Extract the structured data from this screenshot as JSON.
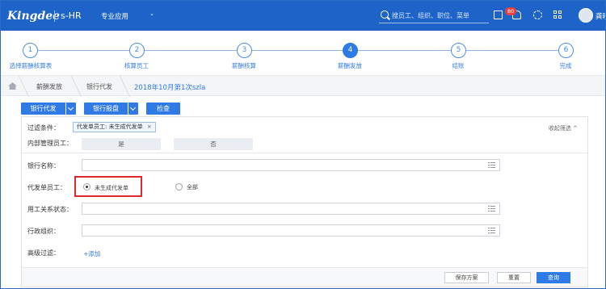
{
  "header": {
    "logo": "Kingdee",
    "product": "s-HR",
    "menu_label": "专业应用",
    "menu_caret": "⌄",
    "search_placeholder": "搜员工、组织、职位、菜单",
    "notification_count": "80",
    "user_name": "龚晓"
  },
  "steps": [
    {
      "num": "1",
      "label": "选择薪酬核算表"
    },
    {
      "num": "2",
      "label": "核算员工"
    },
    {
      "num": "3",
      "label": "薪酬核算"
    },
    {
      "num": "4",
      "label": "薪酬发放",
      "active": true
    },
    {
      "num": "5",
      "label": "结账"
    },
    {
      "num": "6",
      "label": "完成"
    }
  ],
  "breadcrumb": {
    "items": [
      "薪酬发放",
      "银行代发",
      "2018年10月第1次szla"
    ]
  },
  "toolbar": {
    "bank_payment": "银行代发",
    "bank_report": "银行报盘",
    "check": "检查"
  },
  "filter": {
    "condition_label": "过滤条件：",
    "condition_tag": "代发单员工: 未生成代发单",
    "tag_close": "×",
    "collapse_label": "收起筛选 ^",
    "internal_label": "内部管理员工：",
    "internal_options": [
      "是",
      "否"
    ],
    "bank_name_label": "银行名称：",
    "payment_label": "代发单员工：",
    "payment_options": [
      "未生成代发单",
      "全部"
    ],
    "employment_label": "用工关系状态：",
    "org_label": "行政组织：",
    "advanced_label": "高级过滤：",
    "add_link": "+添加",
    "save_plan": "保存方案",
    "reset": "重置",
    "query": "查询"
  },
  "colors": {
    "brand_blue": "#1e63c8",
    "accent_blue": "#2f7ae5",
    "highlight_red": "#e0282e"
  }
}
